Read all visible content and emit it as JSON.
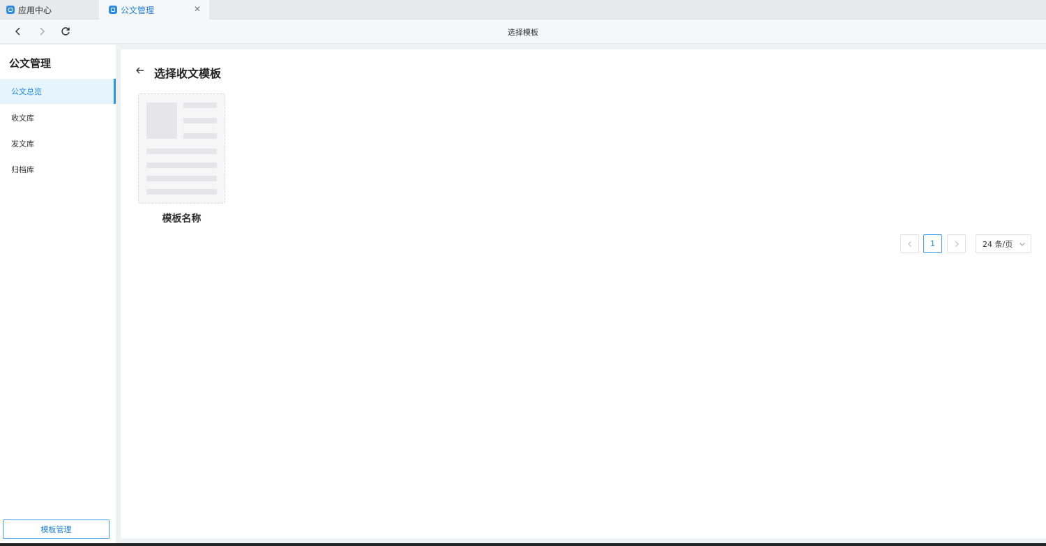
{
  "tabs": [
    {
      "label": "应用中心"
    },
    {
      "label": "公文管理",
      "active": true
    }
  ],
  "nav": {
    "title": "选择模板"
  },
  "sidebar": {
    "title": "公文管理",
    "items": [
      {
        "label": "公文总览",
        "active": true
      },
      {
        "label": "收文库"
      },
      {
        "label": "发文库"
      },
      {
        "label": "归档库"
      }
    ],
    "manage_button": "模板管理"
  },
  "main": {
    "title": "选择收文模板",
    "templates": [
      {
        "name": "模板名称"
      }
    ]
  },
  "pagination": {
    "current_page": "1",
    "page_size": "24 条/页"
  },
  "colors": {
    "accent": "#1e8ae0",
    "active_bg": "#e6f4fd"
  }
}
